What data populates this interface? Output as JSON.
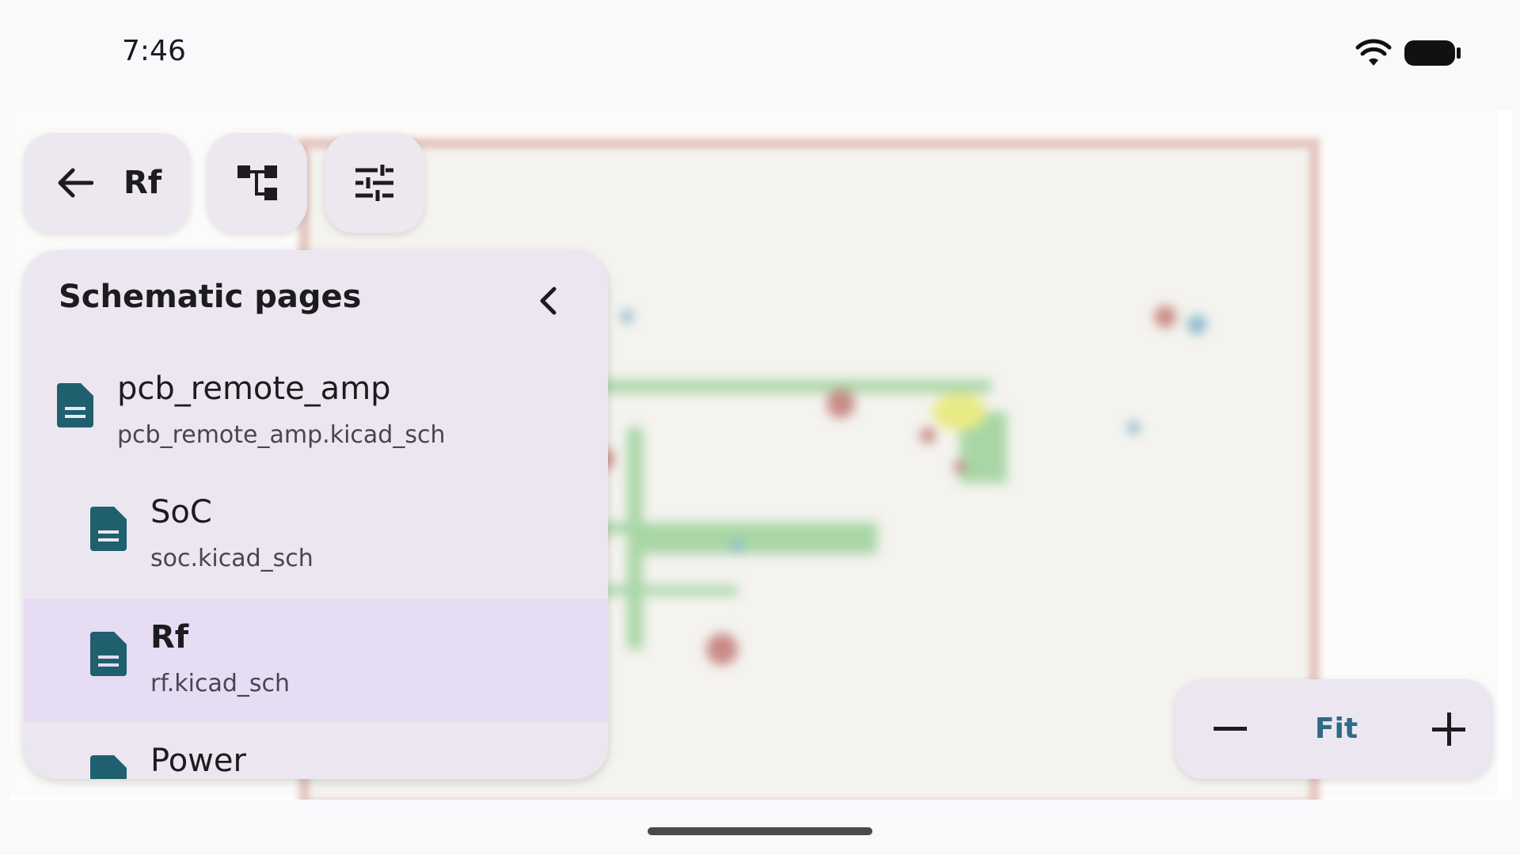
{
  "status_bar": {
    "time": "7:46"
  },
  "toolbar": {
    "back_label": "Rf"
  },
  "panel": {
    "title": "Schematic pages",
    "items": [
      {
        "title": "pcb_remote_amp",
        "subtitle": "pcb_remote_amp.kicad_sch",
        "selected": false
      },
      {
        "title": "SoC",
        "subtitle": "soc.kicad_sch",
        "selected": false
      },
      {
        "title": "Rf",
        "subtitle": "rf.kicad_sch",
        "selected": true
      },
      {
        "title": "Power",
        "subtitle": "",
        "selected": false
      }
    ]
  },
  "zoom": {
    "fit_label": "Fit"
  },
  "colors": {
    "surface": "#ece6f0",
    "selected": "#e6dcf4",
    "icon_teal": "#1f5f6e",
    "accent": "#2f6a86"
  }
}
